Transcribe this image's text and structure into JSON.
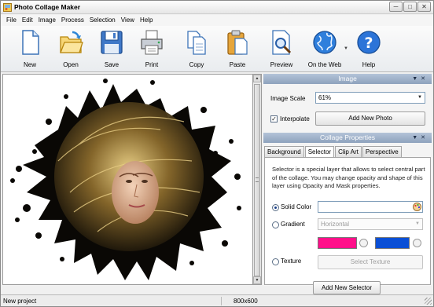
{
  "window": {
    "title": "Photo Collage Maker",
    "controls": [
      "─",
      "□",
      "✕"
    ]
  },
  "menu": [
    "File",
    "Edit",
    "Image",
    "Process",
    "Selection",
    "View",
    "Help"
  ],
  "toolbar": [
    {
      "label": "New",
      "icon": "new-document-icon"
    },
    {
      "label": "Open",
      "icon": "open-folder-icon"
    },
    {
      "label": "Save",
      "icon": "floppy-disk-icon"
    },
    {
      "label": "Print",
      "icon": "printer-icon"
    },
    {
      "label": "Copy",
      "icon": "copy-icon"
    },
    {
      "label": "Paste",
      "icon": "paste-clipboard-icon"
    },
    {
      "label": "Preview",
      "icon": "preview-magnifier-icon"
    },
    {
      "label": "On the Web",
      "icon": "globe-icon"
    },
    {
      "label": "Help",
      "icon": "help-question-icon"
    }
  ],
  "image_panel": {
    "header": "Image",
    "scale_label": "Image Scale",
    "scale_value": "61%",
    "interpolate_label": "Interpolate",
    "interpolate_checked": true,
    "add_photo_button": "Add New Photo"
  },
  "collage_panel": {
    "header": "Collage Properties",
    "tabs": [
      "Background",
      "Selector",
      "Clip Art",
      "Perspective"
    ],
    "active_tab": "Selector",
    "description": "Selector is a special layer that allows to select central part of the collage. You may change opacity and shape of this layer using Opacity and Mask properties.",
    "solid_color_label": "Solid Color",
    "gradient_label": "Gradient",
    "gradient_value": "Horizontal",
    "texture_label": "Texture",
    "select_texture_button": "Select Texture",
    "add_selector_button": "Add New Selector",
    "selected_option": "Solid Color",
    "colors": {
      "gradient_start": "#ff0f8a",
      "gradient_end": "#0a4fd6"
    }
  },
  "status": {
    "left": "New project",
    "right": "800x600"
  },
  "colors": {
    "panel_header": "#9aadc6",
    "canvas_bg": "#ffffff"
  }
}
